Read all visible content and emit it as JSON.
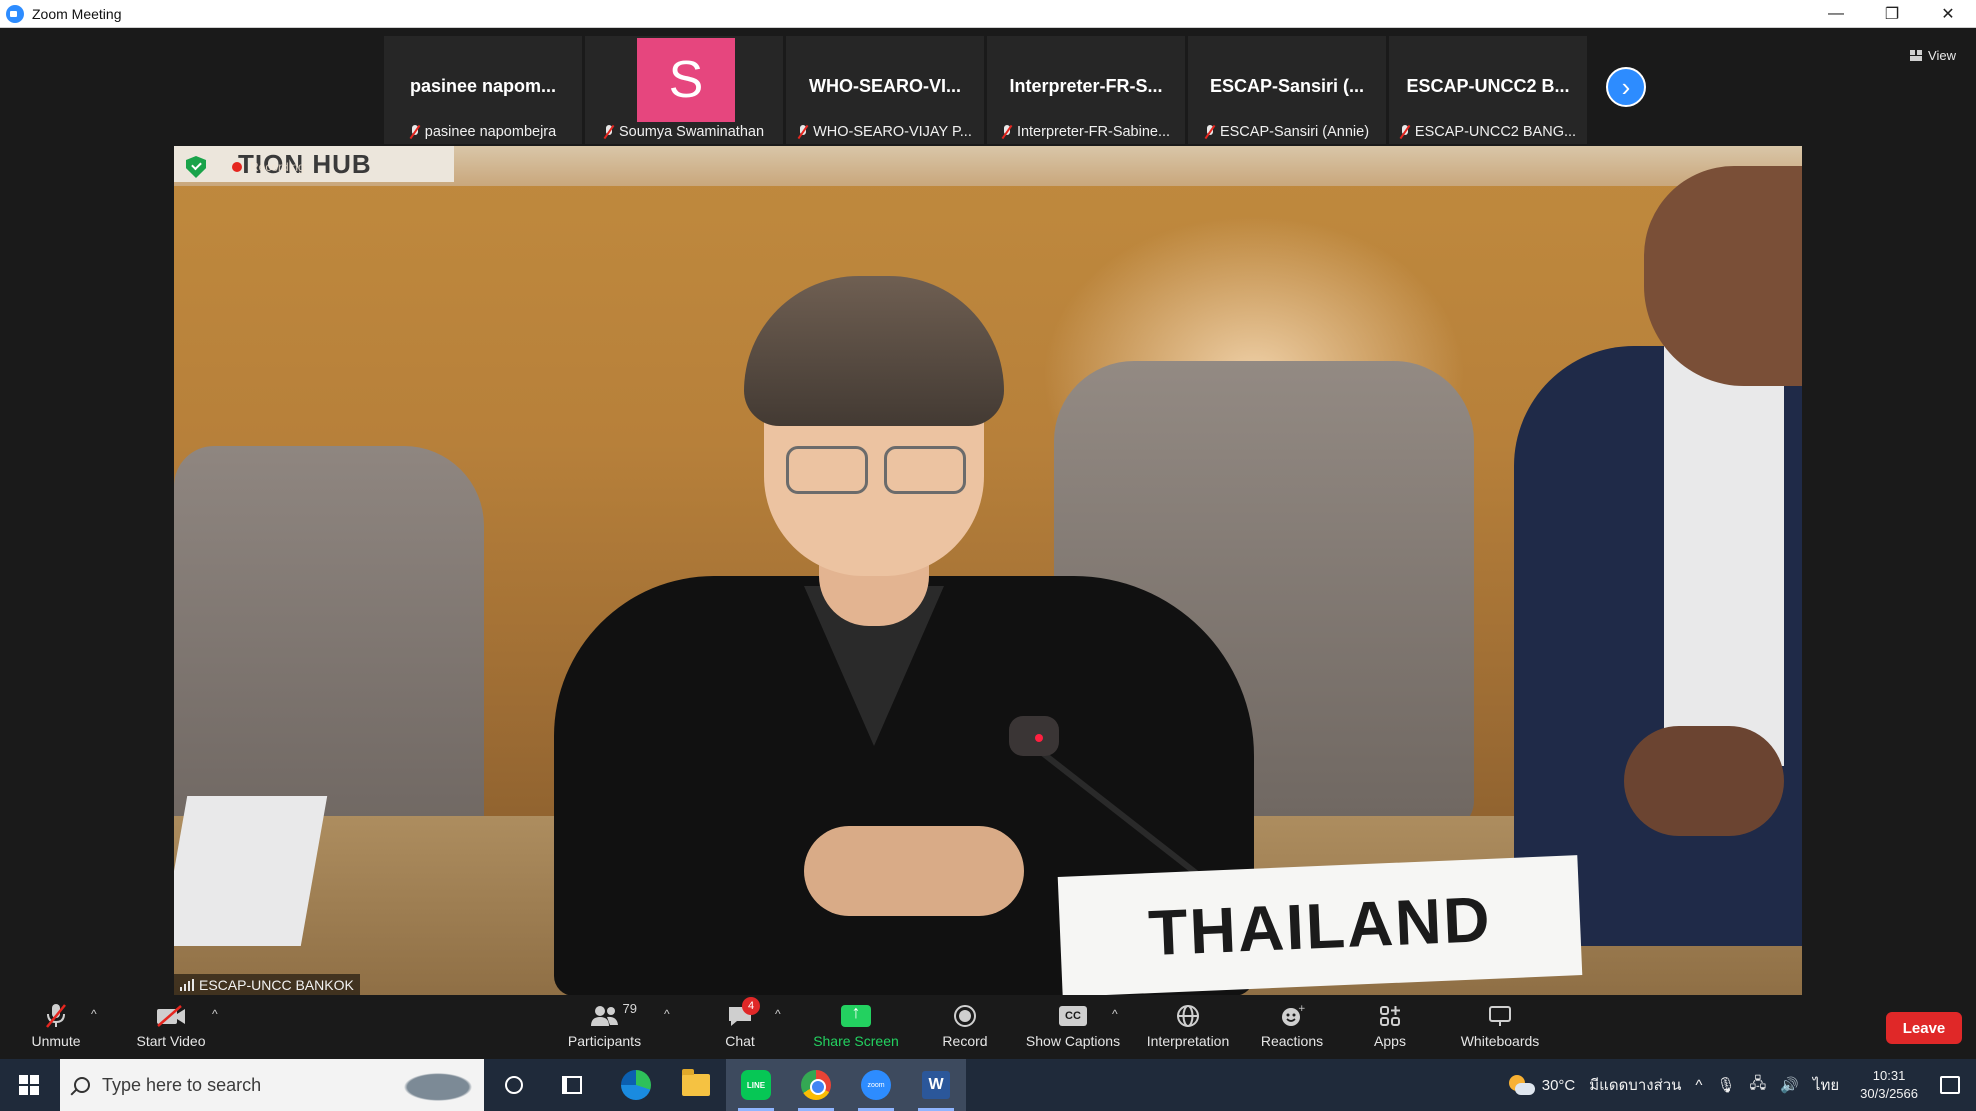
{
  "window": {
    "title": "Zoom Meeting",
    "minimize": "—",
    "restore": "❐",
    "close": "✕"
  },
  "view_button": {
    "label": "View"
  },
  "thumbnails": [
    {
      "big_name": "pasinee napom...",
      "label": "pasinee napombejra"
    },
    {
      "avatar_letter": "S",
      "label": "Soumya Swaminathan"
    },
    {
      "big_name": "WHO-SEARO-VI...",
      "label": "WHO-SEARO-VIJAY P..."
    },
    {
      "big_name": "Interpreter-FR-S...",
      "label": "Interpreter-FR-Sabine..."
    },
    {
      "big_name": "ESCAP-Sansiri (...",
      "label": "ESCAP-Sansiri (Annie)"
    },
    {
      "big_name": "ESCAP-UNCC2 B...",
      "label": "ESCAP-UNCC2 BANG..."
    }
  ],
  "next_page_button": {
    "symbol": "›"
  },
  "main_video": {
    "recording_label": "Recording",
    "participant_label": "ESCAP-UNCC BANKOK",
    "sign_text": "TION HUB",
    "nameplate": "THAILAND"
  },
  "toolbar": {
    "unmute": "Unmute",
    "start_video": "Start Video",
    "participants": "Participants",
    "participants_count": "79",
    "chat": "Chat",
    "chat_badge": "4",
    "share_screen": "Share Screen",
    "record": "Record",
    "show_captions": "Show Captions",
    "captions_icon": "CC",
    "interpretation": "Interpretation",
    "reactions": "Reactions",
    "apps": "Apps",
    "whiteboards": "Whiteboards",
    "leave": "Leave",
    "caret": "^"
  },
  "taskbar": {
    "search_placeholder": "Type here to search",
    "line_label": "LINE",
    "zoom_label": "zoom",
    "word_label": "W",
    "weather": "30°C",
    "weather_desc": "มีแดดบางส่วน",
    "language": "ไทย",
    "time": "10:31",
    "date": "30/3/2566",
    "tray_up": "^",
    "mic_symbol": "🎙",
    "network_symbol": "🖧",
    "volume_symbol": "🔊"
  },
  "colors": {
    "accent": "#2d8cff",
    "leave": "#e02828",
    "share": "#23d160",
    "avatar": "#e6467e",
    "muted": "#e5261f"
  }
}
